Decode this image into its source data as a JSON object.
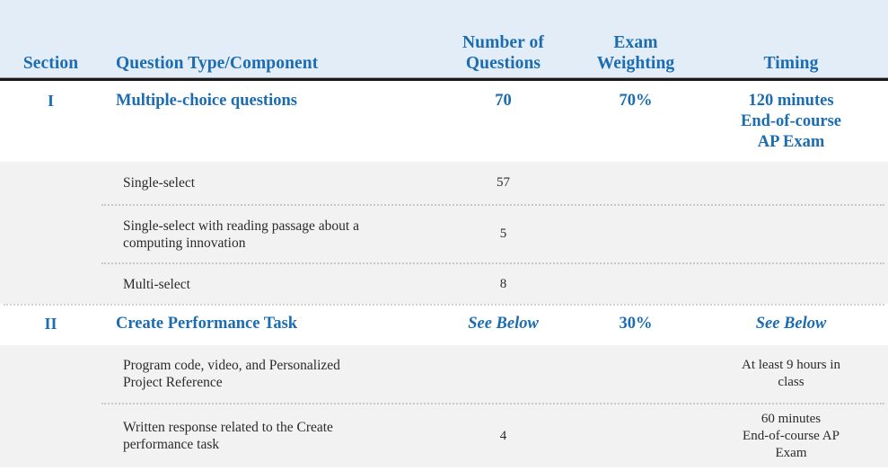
{
  "table": {
    "headers": {
      "section": "Section",
      "question_type": "Question Type/Component",
      "number_of_questions": "Number of Questions",
      "number_of_questions_line1": "Number of",
      "number_of_questions_line2": "Questions",
      "exam_weighting": "Exam Weighting",
      "exam_weighting_line1": "Exam",
      "exam_weighting_line2": "Weighting",
      "timing": "Timing"
    },
    "colors": {
      "header_background": "#e3edf8",
      "heading_text": "#1b6cb0",
      "subrow_background": "#f2f2f2",
      "rule": "#1a1a1a",
      "dotted_rule": "#c8c8c8",
      "body_text": "#2b2b2b"
    },
    "rows": [
      {
        "kind": "section",
        "section": "I",
        "question_type": "Multiple-choice questions",
        "number_of_questions": "70",
        "exam_weighting": "70%",
        "timing_line1": "120 minutes",
        "timing_line2": "End-of-course",
        "timing_line3": "AP Exam"
      },
      {
        "kind": "sub",
        "section": "",
        "question_type": "Single-select",
        "number_of_questions": "57",
        "exam_weighting": "",
        "timing": ""
      },
      {
        "kind": "sub",
        "section": "",
        "question_type_line1": "Single-select with reading passage about a",
        "question_type_line2": "computing innovation",
        "number_of_questions": "5",
        "exam_weighting": "",
        "timing": ""
      },
      {
        "kind": "sub",
        "section": "",
        "question_type": "Multi-select",
        "number_of_questions": "8",
        "exam_weighting": "",
        "timing": ""
      },
      {
        "kind": "section",
        "section": "II",
        "question_type": "Create Performance Task",
        "number_of_questions": "See Below",
        "exam_weighting": "30%",
        "timing": "See Below"
      },
      {
        "kind": "sub",
        "section": "",
        "question_type_line1": "Program code, video, and Personalized",
        "question_type_line2": "Project Reference",
        "number_of_questions": "",
        "exam_weighting": "",
        "timing_line1": "At least 9 hours in",
        "timing_line2": "class"
      },
      {
        "kind": "sub",
        "section": "",
        "question_type_line1": "Written response related to the Create",
        "question_type_line2": "performance task",
        "number_of_questions": "4",
        "exam_weighting": "",
        "timing_line1": "60 minutes",
        "timing_line2": "End-of-course AP",
        "timing_line3": "Exam"
      }
    ]
  }
}
